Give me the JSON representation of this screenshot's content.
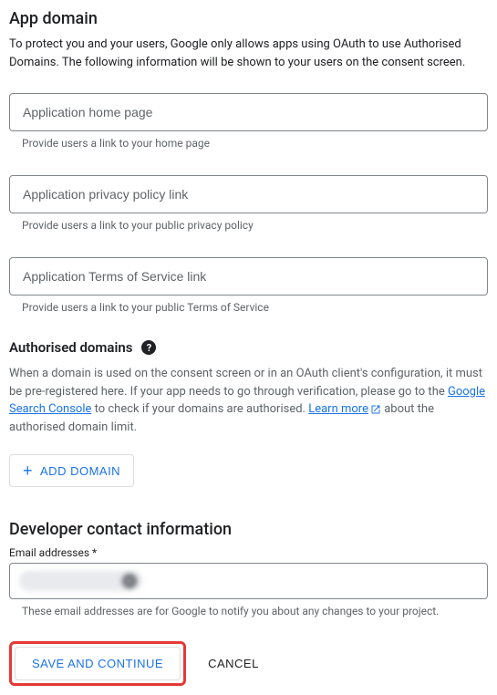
{
  "app_domain": {
    "title": "App domain",
    "description": "To protect you and your users, Google only allows apps using OAuth to use Authorised Domains. The following information will be shown to your users on the consent screen.",
    "fields": [
      {
        "placeholder": "Application home page",
        "helper": "Provide users a link to your home page"
      },
      {
        "placeholder": "Application privacy policy link",
        "helper": "Provide users a link to your public privacy policy"
      },
      {
        "placeholder": "Application Terms of Service link",
        "helper": "Provide users a link to your public Terms of Service"
      }
    ]
  },
  "authorised_domains": {
    "title": "Authorised domains",
    "para_prefix": "When a domain is used on the consent screen or in an OAuth client's configuration, it must be pre-registered here. If your app needs to go through verification, please go to the ",
    "link1": "Google Search Console",
    "para_mid": " to check if your domains are authorised. ",
    "link2": "Learn more",
    "para_suffix": " about the authorised domain limit.",
    "add_button": "ADD DOMAIN"
  },
  "developer_contact": {
    "title": "Developer contact information",
    "label": "Email addresses *",
    "chip_text": "xxxxxxxxxxxxxxx",
    "helper": "These email addresses are for Google to notify you about any changes to your project."
  },
  "actions": {
    "save": "SAVE AND CONTINUE",
    "cancel": "CANCEL"
  }
}
